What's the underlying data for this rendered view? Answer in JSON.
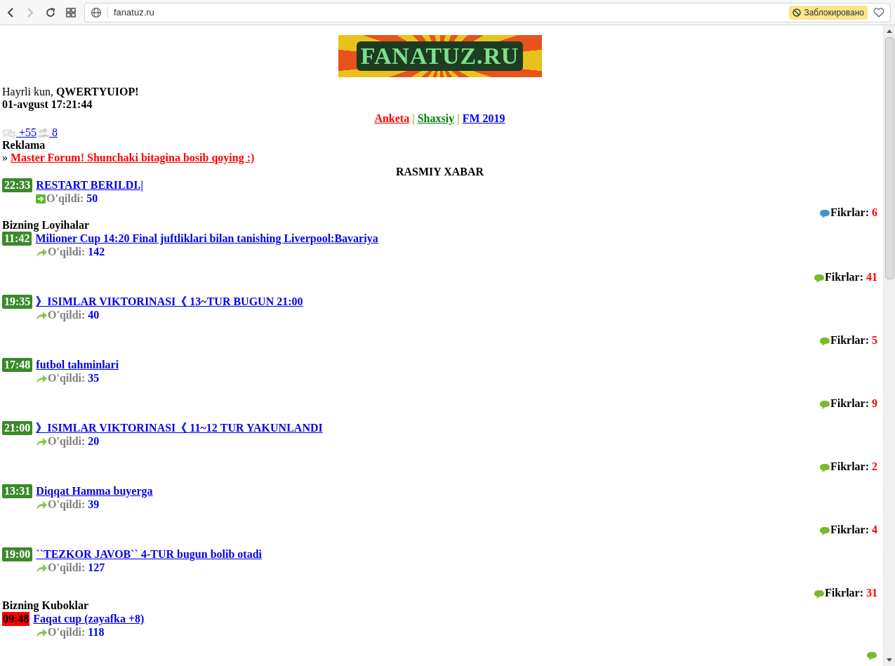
{
  "browser": {
    "url": "fanatuz.ru",
    "blocked_badge": "Заблокировано"
  },
  "logo": {
    "text": "FANATUZ.RU"
  },
  "greeting": {
    "prefix": "Hayrli kun, ",
    "name": "QWERTYUIOP!"
  },
  "datetime": "01-avgust 17:21:44",
  "nav_links": [
    {
      "label": "Anketa",
      "color": "#ff0000"
    },
    {
      "label": "Shaxsiy",
      "color": "#008000"
    },
    {
      "label": "FM 2019",
      "color": "#0000ff"
    }
  ],
  "nav_separator": "|",
  "counters": [
    {
      "kind": "messages",
      "text": " +55"
    },
    {
      "kind": "users",
      "text": " 8"
    }
  ],
  "ad": {
    "heading": "Reklama",
    "marker": "»",
    "link": "Master Forum! Shunchaki bitagina bosib qoying :)"
  },
  "sections": [
    {
      "title": "RASMIY XABAR",
      "kind": "centered",
      "posts": [
        {
          "time": "22:33",
          "color": "#3a8a2a",
          "title": "RESTART BERILDI.|",
          "reads": {
            "kind": "box",
            "label": "O'qildi:",
            "value": "50"
          },
          "comments": {
            "color": "#3e95d0",
            "label": "Fikrlar:",
            "value": "6"
          }
        }
      ]
    },
    {
      "title": "Bizning Loyihalar",
      "kind": "left",
      "posts": [
        {
          "time": "11:42",
          "color": "#3a8a2a",
          "title": "Milioner Cup 14:20 Final juftliklari bilan tanishing Liverpool:Bavariya",
          "reads": {
            "kind": "curved",
            "label": "O'qildi:",
            "value": "142"
          },
          "comments": {
            "color": "#7cb82f",
            "label": "Fikrlar:",
            "value": "41"
          }
        },
        {
          "time": "19:35",
          "color": "#3a8a2a",
          "title": "》ISIMLAR VIKTORINASI《 13~TUR BUGUN 21:00",
          "reads": {
            "kind": "curved",
            "label": "O'qildi:",
            "value": "40"
          },
          "comments": {
            "color": "#7cb82f",
            "label": "Fikrlar:",
            "value": "5"
          }
        },
        {
          "time": "17:48",
          "color": "#3a8a2a",
          "title": "futbol tahminlari",
          "reads": {
            "kind": "curved",
            "label": "O'qildi:",
            "value": "35"
          },
          "comments": {
            "color": "#7cb82f",
            "label": "Fikrlar:",
            "value": "9"
          }
        },
        {
          "time": "21:00",
          "color": "#3a8a2a",
          "title": "》ISIMLAR VIKTORINASI《 11~12 TUR YAKUNLANDI",
          "reads": {
            "kind": "curved",
            "label": "O'qildi:",
            "value": "20"
          },
          "comments": {
            "color": "#7cb82f",
            "label": "Fikrlar:",
            "value": "2"
          }
        },
        {
          "time": "13:31",
          "color": "#3a8a2a",
          "title": "Diqqat Hamma buyerga",
          "reads": {
            "kind": "curved",
            "label": "O'qildi:",
            "value": "39"
          },
          "comments": {
            "color": "#7cb82f",
            "label": "Fikrlar:",
            "value": "4"
          }
        },
        {
          "time": "19:00",
          "color": "#3a8a2a",
          "title": "``TEZKOR JAVOB`` 4-TUR bugun bolib otadi",
          "reads": {
            "kind": "curved",
            "label": "O'qildi:",
            "value": "127"
          },
          "comments": {
            "color": "#7cb82f",
            "label": "Fikrlar:",
            "value": "31"
          }
        }
      ]
    },
    {
      "title": "Bizning Kuboklar",
      "kind": "left",
      "posts": [
        {
          "time": "09:48",
          "color": "#ff0000",
          "title": "Faqat cup (zayafka +8)",
          "reads": {
            "kind": "curved",
            "label": "O'qildi:",
            "value": "118"
          },
          "comments": {
            "color": "#7cb82f"
          }
        }
      ]
    }
  ]
}
